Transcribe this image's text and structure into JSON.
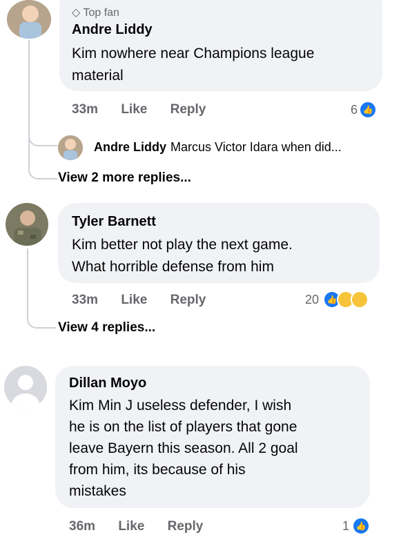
{
  "comments": [
    {
      "badge": "Top fan",
      "author": "Andre Liddy",
      "text_lines": [
        "Kim nowhere near Champions league",
        "material"
      ],
      "time": "33m",
      "like": "Like",
      "reply": "Reply",
      "reactions": "6",
      "reply_preview": {
        "author": "Andre Liddy",
        "text": "Marcus Victor Idara when did..."
      },
      "view_replies": "View 2 more replies..."
    },
    {
      "author": "Tyler Barnett",
      "text_lines": [
        "Kim better not play the next game.",
        "What horrible defense from him"
      ],
      "time": "33m",
      "like": "Like",
      "reply": "Reply",
      "reactions": "20",
      "view_replies": "View 4 replies..."
    },
    {
      "author": "Dillan Moyo",
      "text_lines": [
        "Kim Min J useless defender, I wish",
        "he is on the list of players that gone",
        "leave Bayern this season. All 2 goal",
        "from him, its because of his",
        "mistakes"
      ],
      "time": "36m",
      "like": "Like",
      "reply": "Reply",
      "reactions": "1"
    }
  ],
  "colors": {
    "bubble": "#f0f2f5",
    "like_blue": "#1877f2",
    "meta_gray": "#65676b"
  }
}
